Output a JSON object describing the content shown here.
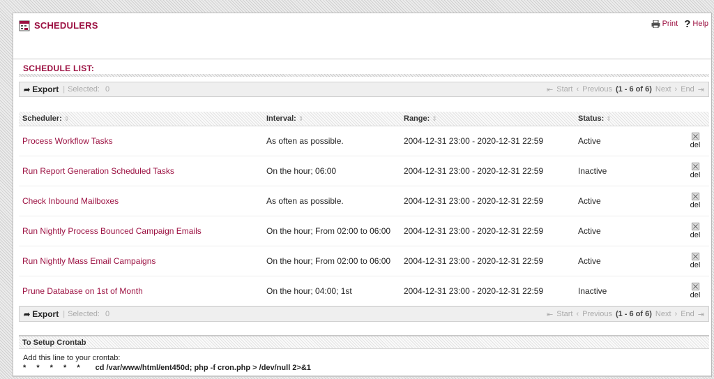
{
  "header": {
    "title": "SCHEDULERS",
    "print_label": "Print",
    "help_label": "Help"
  },
  "list": {
    "title": "SCHEDULE LIST:"
  },
  "toolbar": {
    "export_label": "Export",
    "selected_label": "Selected:",
    "selected_count": "0",
    "pager": {
      "start": "Start",
      "previous": "Previous",
      "count": "(1 - 6 of 6)",
      "next": "Next",
      "end": "End"
    }
  },
  "columns": [
    "Scheduler:",
    "Interval:",
    "Range:",
    "Status:"
  ],
  "rows": [
    {
      "name": "Process Workflow Tasks",
      "interval": "As often as possible.",
      "range": "2004-12-31 23:00 - 2020-12-31 22:59",
      "status": "Active",
      "del": "del"
    },
    {
      "name": "Run Report Generation Scheduled Tasks",
      "interval": "On the hour; 06:00",
      "range": "2004-12-31 23:00 - 2020-12-31 22:59",
      "status": "Inactive",
      "del": "del"
    },
    {
      "name": "Check Inbound Mailboxes",
      "interval": "As often as possible.",
      "range": "2004-12-31 23:00 - 2020-12-31 22:59",
      "status": "Active",
      "del": "del"
    },
    {
      "name": "Run Nightly Process Bounced Campaign Emails",
      "interval": "On the hour; From 02:00 to 06:00",
      "range": "2004-12-31 23:00 - 2020-12-31 22:59",
      "status": "Active",
      "del": "del"
    },
    {
      "name": "Run Nightly Mass Email Campaigns",
      "interval": "On the hour; From 02:00 to 06:00",
      "range": "2004-12-31 23:00 - 2020-12-31 22:59",
      "status": "Active",
      "del": "del"
    },
    {
      "name": "Prune Database on 1st of Month",
      "interval": "On the hour; 04:00; 1st",
      "range": "2004-12-31 23:00 - 2020-12-31 22:59",
      "status": "Inactive",
      "del": "del"
    }
  ],
  "crontab": {
    "title": "To Setup Crontab",
    "instruction": "Add this line to your crontab:",
    "stars": "* * * * *",
    "command": "cd /var/www/html/ent450d; php -f cron.php > /dev/null 2>&1"
  },
  "icons": {
    "title": "scheduler-icon",
    "print": "printer-icon",
    "help": "help-icon",
    "export": "arrow-icon",
    "sort": "sort-icon",
    "delete": "delete-icon"
  },
  "colors": {
    "accent": "#9c1142",
    "toolbar_bg": "#efefef",
    "disabled": "#aaaaaa"
  }
}
